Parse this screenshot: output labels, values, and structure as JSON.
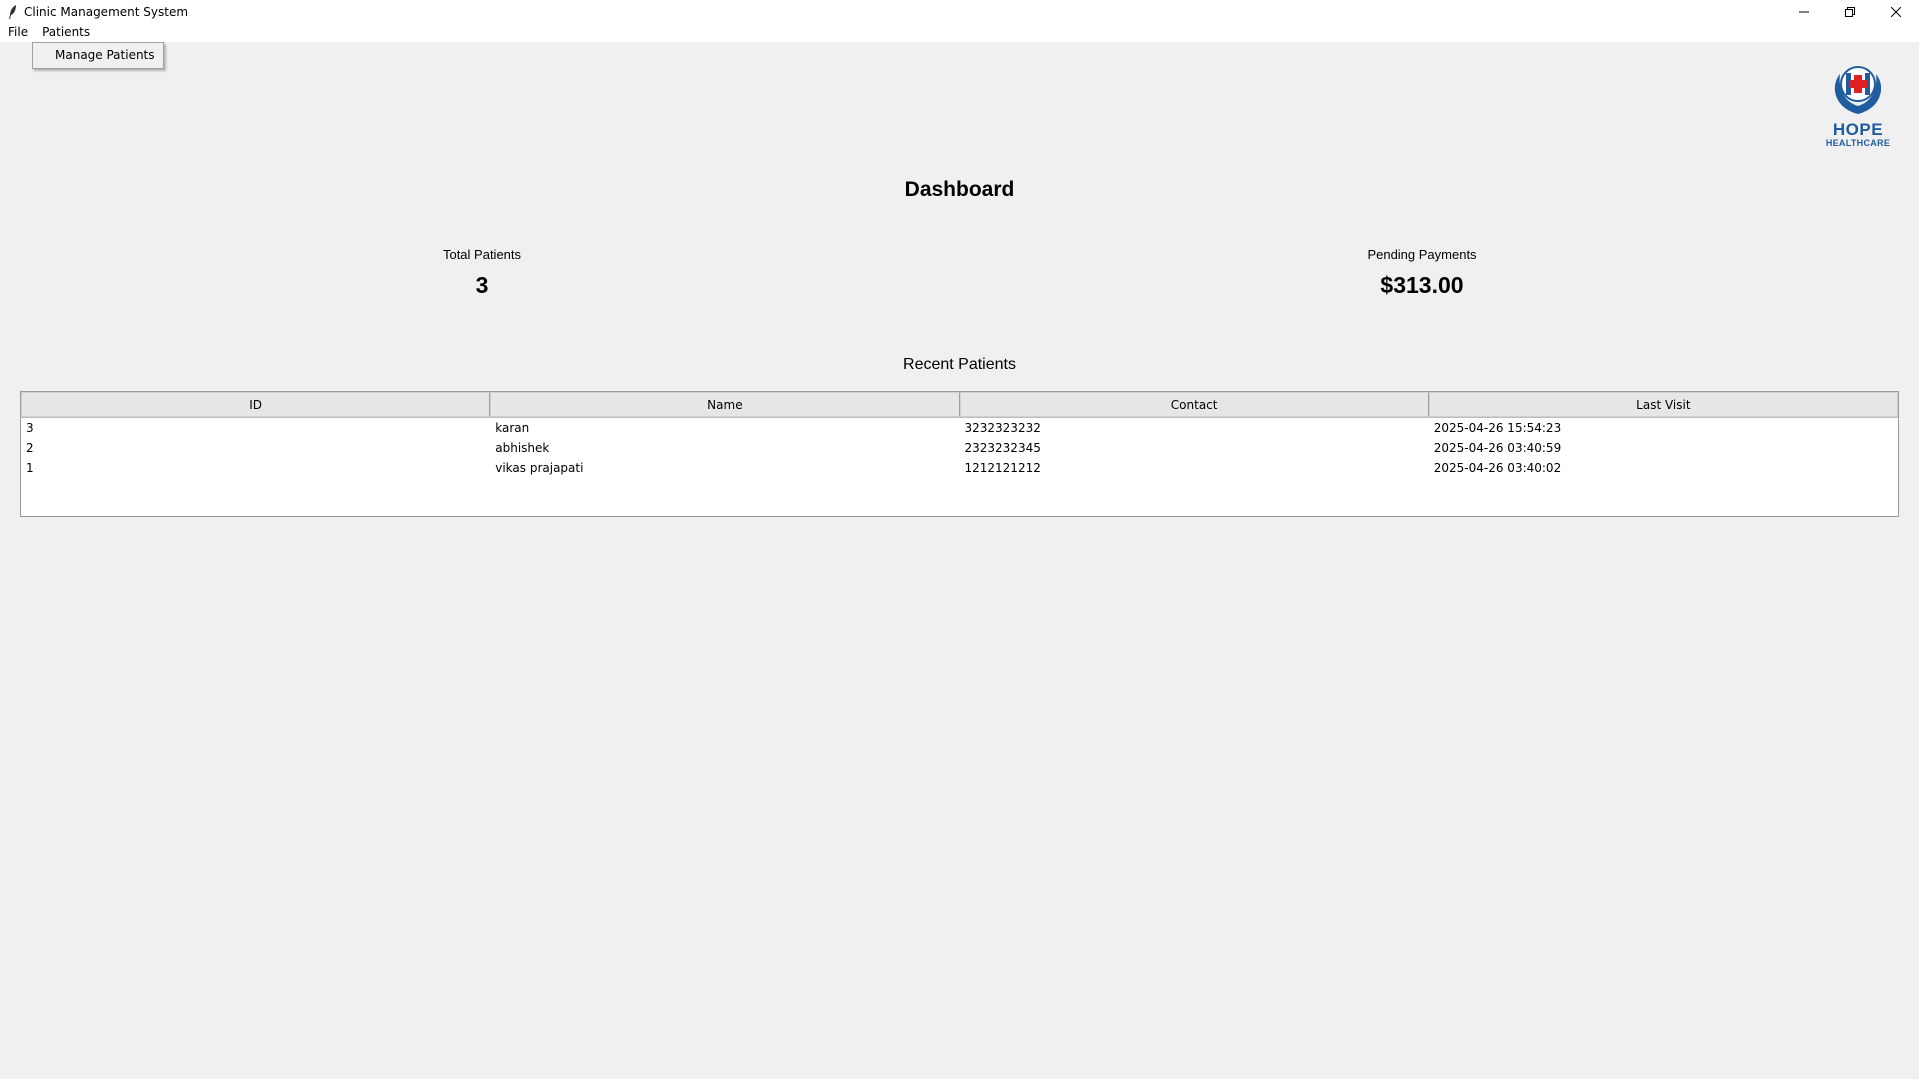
{
  "window": {
    "title": "Clinic Management System"
  },
  "menubar": {
    "items": [
      {
        "label": "File"
      },
      {
        "label": "Patients"
      }
    ],
    "dropdown": {
      "items": [
        {
          "label": "Manage Patients"
        }
      ]
    }
  },
  "logo": {
    "word_top": "HOPE",
    "word_bottom": "HEALTHCARE",
    "colors": {
      "blue": "#1f5d9f",
      "red": "#e02020"
    }
  },
  "dashboard": {
    "title": "Dashboard",
    "stats": {
      "total_patients_label": "Total Patients",
      "total_patients_value": "3",
      "pending_payments_label": "Pending Payments",
      "pending_payments_value": "$313.00"
    },
    "recent_title": "Recent Patients"
  },
  "table": {
    "columns": [
      "ID",
      "Name",
      "Contact",
      "Last Visit"
    ],
    "rows": [
      [
        "3",
        "karan",
        "3232323232",
        "2025-04-26 15:54:23"
      ],
      [
        "2",
        "abhishek",
        "2323232345",
        "2025-04-26 03:40:59"
      ],
      [
        "1",
        "vikas prajapati",
        "1212121212",
        "2025-04-26 03:40:02"
      ]
    ]
  },
  "icons": {
    "app": "feather-icon",
    "minimize": "minimize-icon",
    "maximize": "restore-icon",
    "close": "close-icon"
  }
}
